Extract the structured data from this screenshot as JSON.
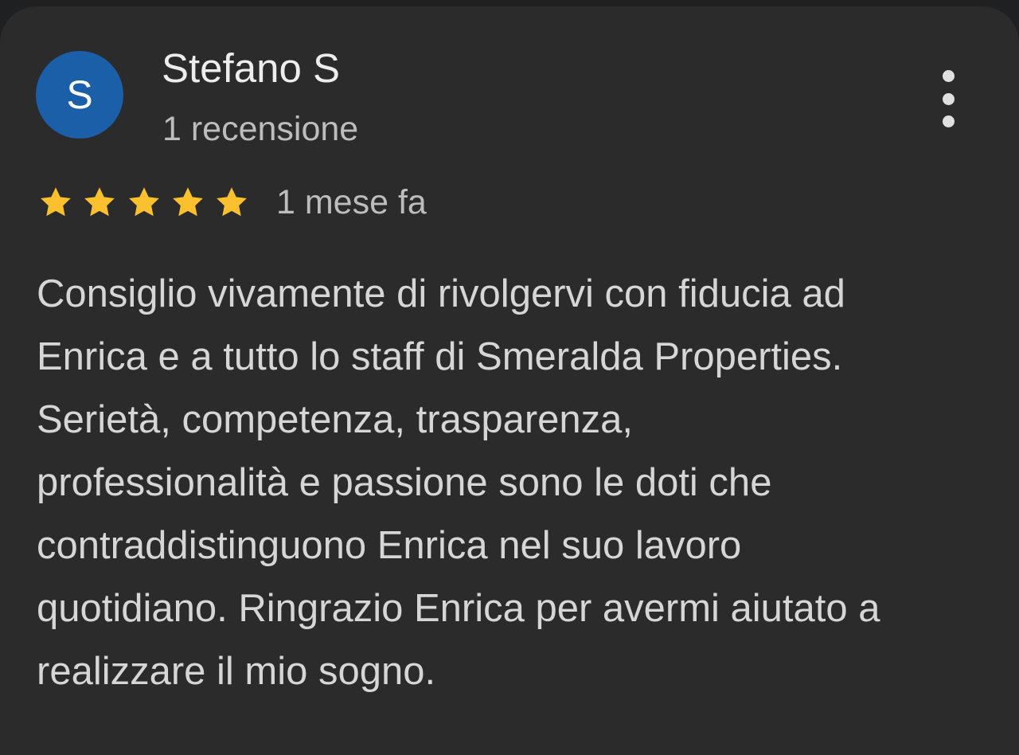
{
  "review": {
    "author": {
      "initial": "S",
      "name": "Stefano S",
      "review_count": "1 recensione",
      "avatar_color": "#1a5fa8"
    },
    "more_options_icon": "more-vert-icon",
    "rating": {
      "stars": 5,
      "max_stars": 5,
      "star_color": "#fbc02d",
      "icon": "star-icon"
    },
    "date": "1 mese fa",
    "text_lines": [
      "Consiglio vivamente di rivolgervi con fiducia ad",
      "Enrica e a tutto lo staff di Smeralda Properties.",
      "Serietà, competenza, trasparenza,",
      "professionalità e passione sono le doti che",
      "contraddistinguono Enrica nel suo lavoro",
      "quotidiano. Ringrazio Enrica per avermi aiutato a",
      "realizzare il mio sogno."
    ]
  },
  "colors": {
    "card_background": "#2b2b2b",
    "page_background": "#1f2021",
    "primary_text": "#ededed",
    "secondary_text": "#bdbdbd"
  }
}
